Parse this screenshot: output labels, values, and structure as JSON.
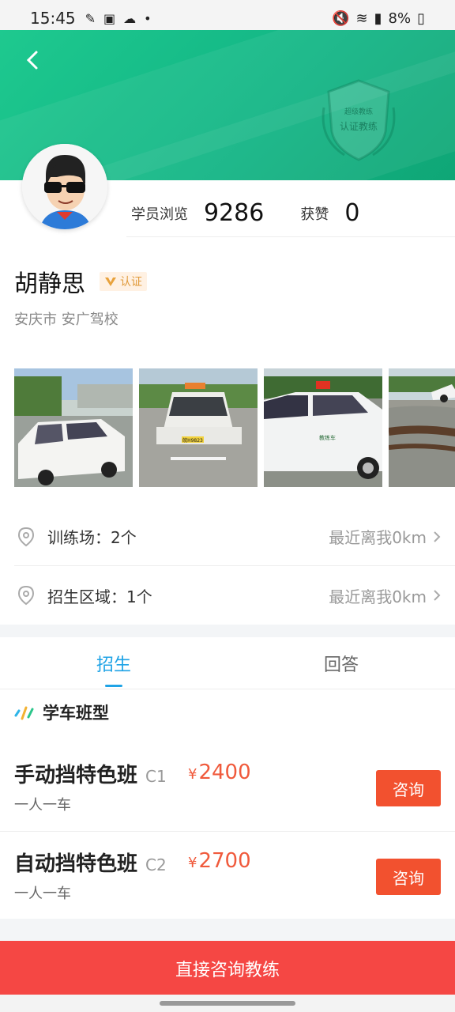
{
  "status_bar": {
    "time": "15:45",
    "battery": "8%",
    "icons_left": [
      "notification-icon",
      "image-icon",
      "cloud-icon",
      "dot-icon"
    ],
    "icons_right": [
      "mute-icon",
      "wifi-icon",
      "signal-icon",
      "battery-icon"
    ]
  },
  "header": {
    "badge_line1": "超级教练",
    "badge_line2": "认证教练",
    "accent": "#1ec98f"
  },
  "profile": {
    "stats": [
      {
        "label": "学员浏览",
        "value": "9286"
      },
      {
        "label": "获赞",
        "value": "0"
      }
    ],
    "name": "胡静思",
    "verified_label": "认证",
    "school": "安庆市 安广驾校"
  },
  "photos": [
    {
      "name": "photo-car-1"
    },
    {
      "name": "photo-car-2",
      "plate": "皖H9823"
    },
    {
      "name": "photo-car-3",
      "door_text": "教练车"
    },
    {
      "name": "photo-car-4"
    }
  ],
  "info_rows": [
    {
      "label": "训练场：2个",
      "right": "最近离我0km"
    },
    {
      "label": "招生区域：1个",
      "right": "最近离我0km"
    }
  ],
  "tabs": [
    {
      "label": "招生",
      "active": true
    },
    {
      "label": "回答",
      "active": false
    }
  ],
  "section": {
    "title": "学车班型"
  },
  "courses": [
    {
      "title": "手动挡特色班",
      "code": "C1",
      "price_symbol": "¥",
      "price": "2400",
      "sub": "一人一车",
      "button": "咨询"
    },
    {
      "title": "自动挡特色班",
      "code": "C2",
      "price_symbol": "¥",
      "price": "2700",
      "sub": "一人一车",
      "button": "咨询"
    }
  ],
  "cta": {
    "label": "直接咨询教练",
    "color": "#f54744"
  }
}
